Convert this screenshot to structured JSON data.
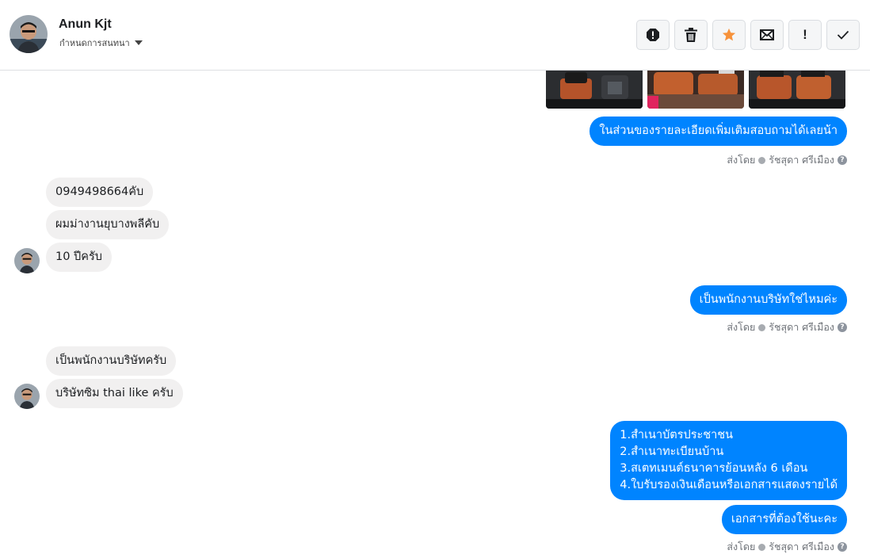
{
  "header": {
    "name": "Anun Kjt",
    "subtitle": "กำหนดการสนทนา",
    "actions": [
      "report-icon",
      "trash-icon",
      "star-icon",
      "mail-icon",
      "important-icon",
      "check-icon"
    ],
    "important_label": "!"
  },
  "colors": {
    "outgoing_bubble": "#0084ff",
    "incoming_bubble": "#f1f0f0",
    "star": "#f7923b"
  },
  "messages": [
    {
      "dir": "out",
      "text": "ในส่วนของรายละเอียดเพิ่มเติมสอบถามได้เลยน้า"
    },
    {
      "dir": "in",
      "text": "0949498664คับ"
    },
    {
      "dir": "in",
      "text": "ผมม่างานยุบางพลีคับ"
    },
    {
      "dir": "in",
      "text": "10 ปีครับ"
    },
    {
      "dir": "out",
      "text": "เป็นพนักงานบริษัทใช่ไหมค่ะ"
    },
    {
      "dir": "in",
      "text": "เป็นพนักงานบริษัทครับ"
    },
    {
      "dir": "in",
      "text": "บริษัทซิม thai like ครับ"
    },
    {
      "dir": "out",
      "text": "1.สำเนาบัตรประชาชน\n2.สำเนาทะเบียนบ้าน\n3.สเตทเมนต์ธนาคารย้อนหลัง 6 เดือน\n4.ใบรับรองเงินเดือนหรือเอกสารแสดงรายได้"
    },
    {
      "dir": "out",
      "text": "เอกสารที่ต้องใช้นะคะ"
    }
  ],
  "sent_by": {
    "prefix": "ส่งโดย",
    "sender": "รัชสุดา ศรีเมือง",
    "help": "?"
  }
}
